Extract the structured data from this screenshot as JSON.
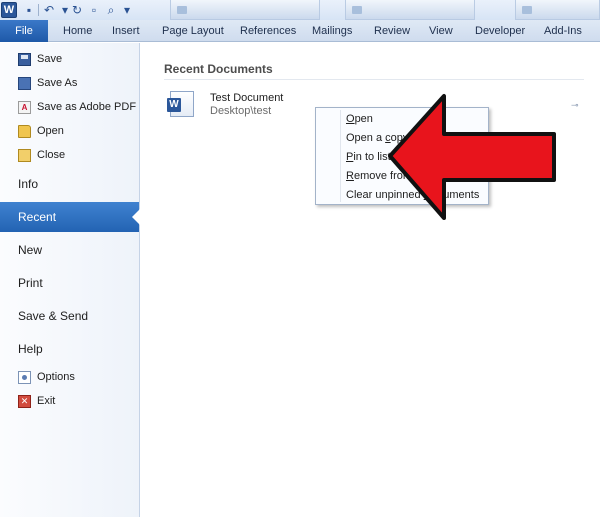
{
  "titlebar": {
    "logo_letter": "W"
  },
  "ribbon": {
    "file_tab": "File",
    "tabs": [
      "Home",
      "Insert",
      "Page Layout",
      "References",
      "Mailings",
      "Review",
      "View",
      "Developer",
      "Add-Ins"
    ]
  },
  "backstage": {
    "commands_top": [
      "Save",
      "Save As",
      "Save as Adobe PDF",
      "Open",
      "Close"
    ],
    "sections_a": [
      "Info",
      "Recent",
      "New",
      "Print",
      "Save & Send",
      "Help"
    ],
    "commands_bottom": [
      "Options",
      "Exit"
    ],
    "active_section": "Recent",
    "pdf_icon_text": "A",
    "exit_icon_text": "✕"
  },
  "recent": {
    "heading": "Recent Documents",
    "documents": [
      {
        "name": "Test Document",
        "path": "Desktop\\test"
      }
    ],
    "doc_icon_letter": "W"
  },
  "context_menu": {
    "items": [
      {
        "pre": "",
        "accel": "O",
        "post": "pen"
      },
      {
        "pre": "Open a ",
        "accel": "c",
        "post": "opy"
      },
      {
        "pre": "",
        "accel": "P",
        "post": "in to list"
      },
      {
        "pre": "",
        "accel": "R",
        "post": "emove from list"
      },
      {
        "pre": "Clear unpinned ",
        "accel": "D",
        "post": "ocuments"
      }
    ]
  },
  "annotation": {
    "arrow_color": "#e8141c"
  },
  "colors": {
    "file_tab": "#2a66b4",
    "active_section": "#2f6fc0"
  }
}
